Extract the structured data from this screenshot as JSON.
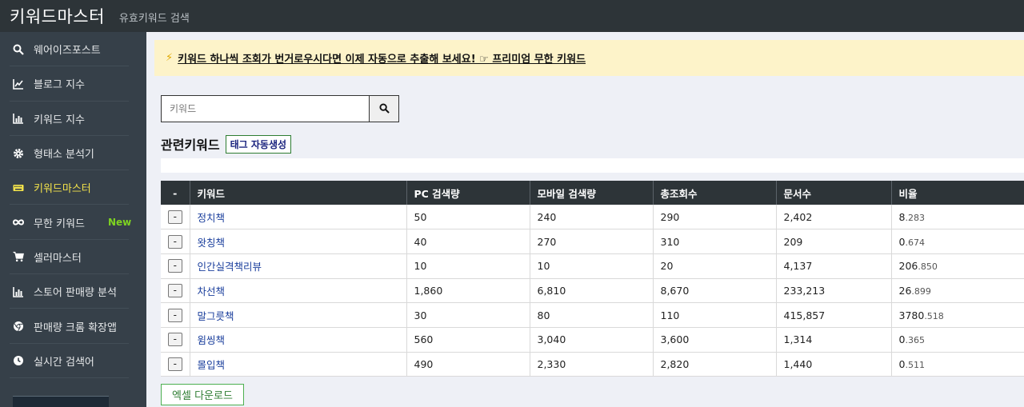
{
  "app": {
    "title": "키워드마스터",
    "subtitle": "유효키워드 검색"
  },
  "sidebar": {
    "items": [
      {
        "label": "웨어이즈포스트",
        "icon": "search-icon"
      },
      {
        "label": "블로그 지수",
        "icon": "line-chart-icon"
      },
      {
        "label": "키워드 지수",
        "icon": "bar-chart-icon"
      },
      {
        "label": "형태소 분석기",
        "icon": "gear-icon"
      },
      {
        "label": "키워드마스터",
        "icon": "keyboard-icon",
        "active": true
      },
      {
        "label": "무한 키워드",
        "icon": "infinity-icon",
        "badge": "New"
      },
      {
        "label": "셀러마스터",
        "icon": "cart-icon"
      },
      {
        "label": "스토어 판매량 분석",
        "icon": "bar-chart-icon"
      },
      {
        "label": "판매량 크롬 확장앱",
        "icon": "chrome-icon"
      },
      {
        "label": "실시간 검색어",
        "icon": "clock-icon"
      }
    ]
  },
  "banner": {
    "text": "키워드 하나씩 조회가 번거로우시다면 이제 자동으로 추출해 보세요! ☞ 프리미엄 무한 키워드",
    "bolt": "⚡"
  },
  "search": {
    "placeholder": "키워드",
    "value": ""
  },
  "related": {
    "title": "관련키워드",
    "tag_button": "태그 자동생성"
  },
  "table": {
    "headers": [
      "-",
      "키워드",
      "PC 검색량",
      "모바일 검색량",
      "총조회수",
      "문서수",
      "비율"
    ],
    "rows": [
      {
        "remove": "-",
        "keyword": "정치책",
        "pc": "50",
        "mobile": "240",
        "total": "290",
        "docs": "2,402",
        "ratio_main": "8",
        "ratio_frac": ".283"
      },
      {
        "remove": "-",
        "keyword": "왓칭책",
        "pc": "40",
        "mobile": "270",
        "total": "310",
        "docs": "209",
        "ratio_main": "0",
        "ratio_frac": ".674"
      },
      {
        "remove": "-",
        "keyword": "인간실격책리뷰",
        "pc": "10",
        "mobile": "10",
        "total": "20",
        "docs": "4,137",
        "ratio_main": "206",
        "ratio_frac": ".850"
      },
      {
        "remove": "-",
        "keyword": "차선책",
        "pc": "1,860",
        "mobile": "6,810",
        "total": "8,670",
        "docs": "233,213",
        "ratio_main": "26",
        "ratio_frac": ".899"
      },
      {
        "remove": "-",
        "keyword": "말그릇책",
        "pc": "30",
        "mobile": "80",
        "total": "110",
        "docs": "415,857",
        "ratio_main": "3780",
        "ratio_frac": ".518"
      },
      {
        "remove": "-",
        "keyword": "윔씽책",
        "pc": "560",
        "mobile": "3,040",
        "total": "3,600",
        "docs": "1,314",
        "ratio_main": "0",
        "ratio_frac": ".365"
      },
      {
        "remove": "-",
        "keyword": "몰입책",
        "pc": "490",
        "mobile": "2,330",
        "total": "2,820",
        "docs": "1,440",
        "ratio_main": "0",
        "ratio_frac": ".511"
      }
    ]
  },
  "excel_button": "엑셀 다운로드"
}
